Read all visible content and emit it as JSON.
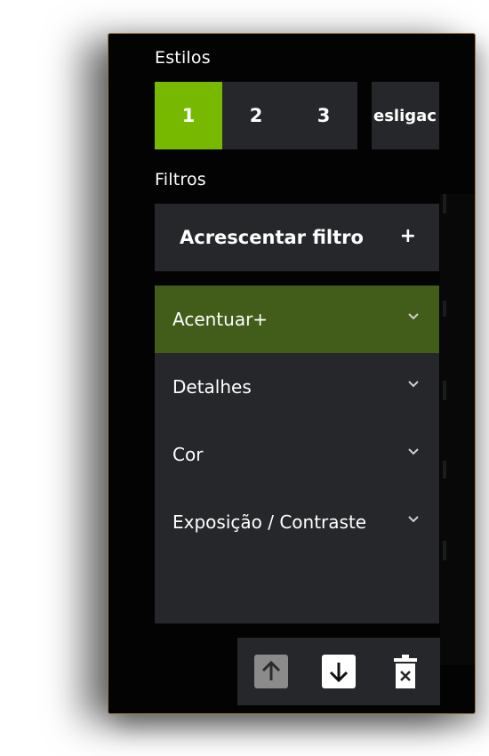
{
  "styles": {
    "title": "Estilos",
    "buttons": [
      {
        "label": "1",
        "active": true
      },
      {
        "label": "2",
        "active": false
      },
      {
        "label": "3",
        "active": false
      },
      {
        "label": "esligac",
        "active": false
      }
    ]
  },
  "filters": {
    "title": "Filtros",
    "add_label": "Acrescentar filtro",
    "add_icon": "+",
    "items": [
      {
        "label": "Acentuar+",
        "selected": true
      },
      {
        "label": "Detalhes",
        "selected": false
      },
      {
        "label": "Cor",
        "selected": false
      },
      {
        "label": "Exposição / Contraste",
        "selected": false
      }
    ]
  },
  "toolbar": {
    "move_up_icon": "arrow-up-icon",
    "move_down_icon": "arrow-down-icon",
    "delete_icon": "trash-icon",
    "move_up_enabled": false,
    "move_down_enabled": true
  },
  "colors": {
    "accent": "#76b900",
    "selected_filter": "#425c19",
    "panel_bg": "#030303",
    "item_bg": "#26272a"
  }
}
